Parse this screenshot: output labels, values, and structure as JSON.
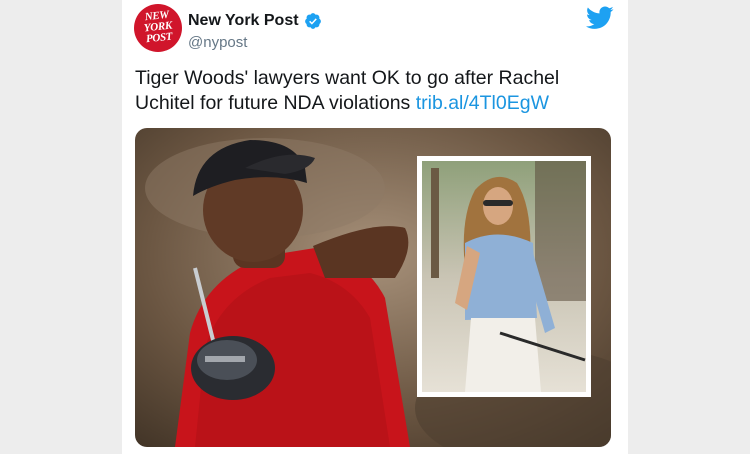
{
  "account": {
    "name": "New York Post",
    "handle": "@nypost",
    "avatar_text": [
      "NEW",
      "YORK",
      "POST"
    ],
    "brand_color": "#d0152b",
    "verified": true
  },
  "tweet": {
    "text": "Tiger Woods' lawyers want OK to go after Rachel Uchitel for future NDA violations ",
    "link": "trib.al/4Tl0EgW"
  },
  "icons": {
    "verified": "verified-badge-icon",
    "platform": "twitter-bird-icon"
  },
  "colors": {
    "link": "#1b95e0",
    "twitter_blue": "#1da1f2",
    "text": "#14171a",
    "secondary": "#657786"
  }
}
